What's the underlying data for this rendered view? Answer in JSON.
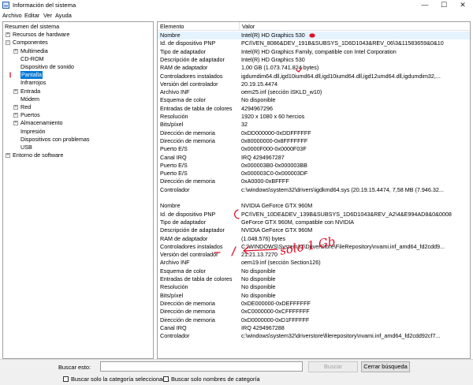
{
  "window": {
    "title": "Información del sistema",
    "minimize": "—",
    "maximize": "☐",
    "close": "✕"
  },
  "menu": [
    "Archivo",
    "Editar",
    "Ver",
    "Ayuda"
  ],
  "tree": [
    {
      "label": "Resumen del sistema",
      "level": 0,
      "expander": ""
    },
    {
      "label": "Recursos de hardware",
      "level": 1,
      "expander": "+"
    },
    {
      "label": "Componentes",
      "level": 1,
      "expander": "−"
    },
    {
      "label": "Multimedia",
      "level": 2,
      "expander": "+"
    },
    {
      "label": "CD-ROM",
      "level": 2,
      "expander": ""
    },
    {
      "label": "Dispositivo de sonido",
      "level": 2,
      "expander": ""
    },
    {
      "label": "Pantalla",
      "level": 2,
      "expander": "",
      "selected": true
    },
    {
      "label": "Infrarrojos",
      "level": 2,
      "expander": ""
    },
    {
      "label": "Entrada",
      "level": 2,
      "expander": "+"
    },
    {
      "label": "Módem",
      "level": 2,
      "expander": ""
    },
    {
      "label": "Red",
      "level": 2,
      "expander": "+"
    },
    {
      "label": "Puertos",
      "level": 2,
      "expander": "+"
    },
    {
      "label": "Almacenamiento",
      "level": 2,
      "expander": "+"
    },
    {
      "label": "Impresión",
      "level": 2,
      "expander": ""
    },
    {
      "label": "Dispositivos con problemas",
      "level": 2,
      "expander": ""
    },
    {
      "label": "USB",
      "level": 2,
      "expander": ""
    },
    {
      "label": "Entorno de software",
      "level": 1,
      "expander": "+"
    }
  ],
  "columns": {
    "item": "Elemento",
    "value": "Valor"
  },
  "rows": [
    {
      "k": "Nombre",
      "v": "Intel(R) HD Graphics 530",
      "hl": true
    },
    {
      "k": "Id. de dispositivo PNP",
      "v": "PCI\\VEN_8086&DEV_191B&SUBSYS_1D6D1043&REV_06\\3&11583659&0&10"
    },
    {
      "k": "Tipo de adaptador",
      "v": "Intel(R) HD Graphics Family, compatible con Intel Corporation"
    },
    {
      "k": "Descripción de adaptador",
      "v": "Intel(R) HD Graphics 530"
    },
    {
      "k": "RAM de adaptador",
      "v": "1,00 GB (1.073.741.824 bytes)"
    },
    {
      "k": "Controladores instalados",
      "v": "igdumdim64.dll,igd10iumd64.dll,igd10iumd64.dll,igd12umd64.dll,igdumdim32,..."
    },
    {
      "k": "Versión del controlador",
      "v": "20.19.15.4474"
    },
    {
      "k": "Archivo INF",
      "v": "oem25.inf (sección iSKLD_w10)"
    },
    {
      "k": "Esquema de color",
      "v": "No disponible"
    },
    {
      "k": "Entradas de tabla de colores",
      "v": "4294967296"
    },
    {
      "k": "Resolución",
      "v": "1920 x 1080 x 60 hercios"
    },
    {
      "k": "Bits/píxel",
      "v": "32"
    },
    {
      "k": "Dirección de memoria",
      "v": "0xDD000000-0xDDFFFFFF"
    },
    {
      "k": "Dirección de memoria",
      "v": "0x80000000-0x8FFFFFFF"
    },
    {
      "k": "Puerto E/S",
      "v": "0x0000F000-0x0000F03F"
    },
    {
      "k": "Canal IRQ",
      "v": "IRQ 4294967287"
    },
    {
      "k": "Puerto E/S",
      "v": "0x000003B0-0x000003BB"
    },
    {
      "k": "Puerto E/S",
      "v": "0x000003C0-0x000003DF"
    },
    {
      "k": "Dirección de memoria",
      "v": "0xA0000-0xBFFFF"
    },
    {
      "k": "Controlador",
      "v": "c:\\windows\\system32\\drivers\\igdkmd64.sys (20.19.15.4474, 7,58 MB (7.946.32..."
    },
    {
      "k": "",
      "v": ""
    },
    {
      "k": "Nombre",
      "v": "NVIDIA GeForce GTX 960M"
    },
    {
      "k": "Id. de dispositivo PNP",
      "v": "PCI\\VEN_10DE&DEV_139B&SUBSYS_1D6D1043&REV_A2\\4&E994AD8&0&0008"
    },
    {
      "k": "Tipo de adaptador",
      "v": "GeForce GTX 960M, compatible con NVIDIA"
    },
    {
      "k": "Descripción de adaptador",
      "v": "NVIDIA GeForce GTX 960M"
    },
    {
      "k": "RAM de adaptador",
      "v": "(1.048.576) bytes"
    },
    {
      "k": "Controladores instalados",
      "v": "C:\\WINDOWS\\System32\\DriverStore\\FileRepository\\nvami.inf_amd64_fd2cdd9..."
    },
    {
      "k": "Versión del controlador",
      "v": "21.21.13.7270"
    },
    {
      "k": "Archivo INF",
      "v": "oem19.inf (sección Section126)"
    },
    {
      "k": "Esquema de color",
      "v": "No disponible"
    },
    {
      "k": "Entradas de tabla de colores",
      "v": "No disponible"
    },
    {
      "k": "Resolución",
      "v": "No disponible"
    },
    {
      "k": "Bits/píxel",
      "v": "No disponible"
    },
    {
      "k": "Dirección de memoria",
      "v": "0xDE000000-0xDEFFFFFF"
    },
    {
      "k": "Dirección de memoria",
      "v": "0xC0000000-0xCFFFFFFF"
    },
    {
      "k": "Dirección de memoria",
      "v": "0xD0000000-0xD1FFFFFF"
    },
    {
      "k": "Canal IRQ",
      "v": "IRQ 4294967288"
    },
    {
      "k": "Controlador",
      "v": "c:\\windows\\system32\\driverstore\\filerepository\\nvami.inf_amd64_fd2cdd92cf7..."
    }
  ],
  "annotation_text": "solo 1 Gb",
  "annotation_color": "#e0102a",
  "search": {
    "label": "Buscar esto:",
    "value": "",
    "find_button": "Buscar",
    "close_button": "Cerrar búsqueda",
    "check_selected": "Buscar solo la categoría seleccionada",
    "check_names": "Buscar solo nombres de categoría"
  }
}
